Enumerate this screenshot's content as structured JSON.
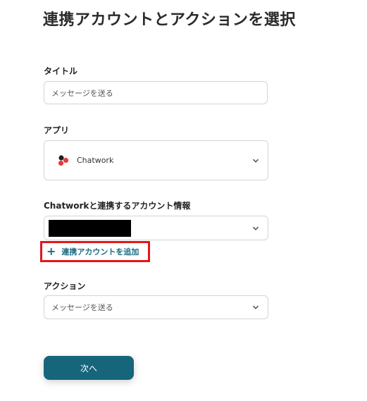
{
  "page": {
    "title": "連携アカウントとアクションを選択"
  },
  "title_field": {
    "label": "タイトル",
    "value": "メッセージを送る"
  },
  "app_field": {
    "label": "アプリ",
    "selected": "Chatwork",
    "icon": "chatwork-logo-icon"
  },
  "account_field": {
    "label": "Chatworkと連携するアカウント情報",
    "selected_redacted": true,
    "add_label": "連携アカウントを追加",
    "highlight_color": "#e0181b"
  },
  "action_field": {
    "label": "アクション",
    "selected": "メッセージを送る"
  },
  "next_button": {
    "label": "次へ",
    "color": "#16657b"
  }
}
